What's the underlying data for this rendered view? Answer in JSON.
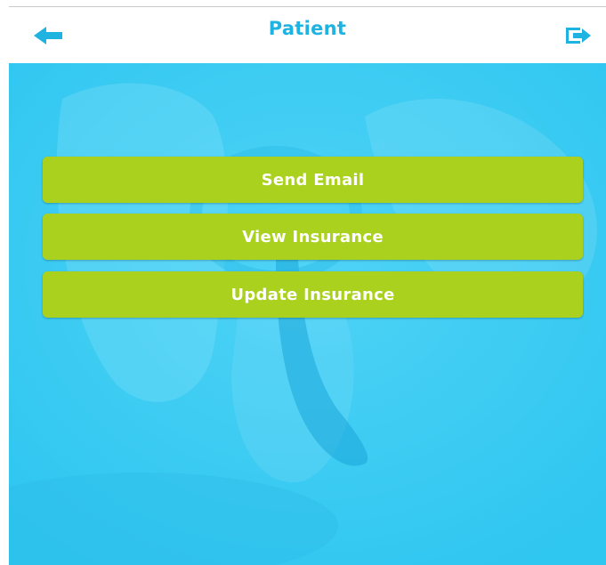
{
  "header": {
    "title": "Patient",
    "back_icon": "arrow-left-icon",
    "logout_icon": "logout-icon",
    "accent_color": "#1fb3e2"
  },
  "actions": [
    {
      "label": "Send Email"
    },
    {
      "label": "View Insurance"
    },
    {
      "label": "Update Insurance"
    }
  ],
  "colors": {
    "button": "#a9d11e",
    "background": "#38cdf4"
  }
}
